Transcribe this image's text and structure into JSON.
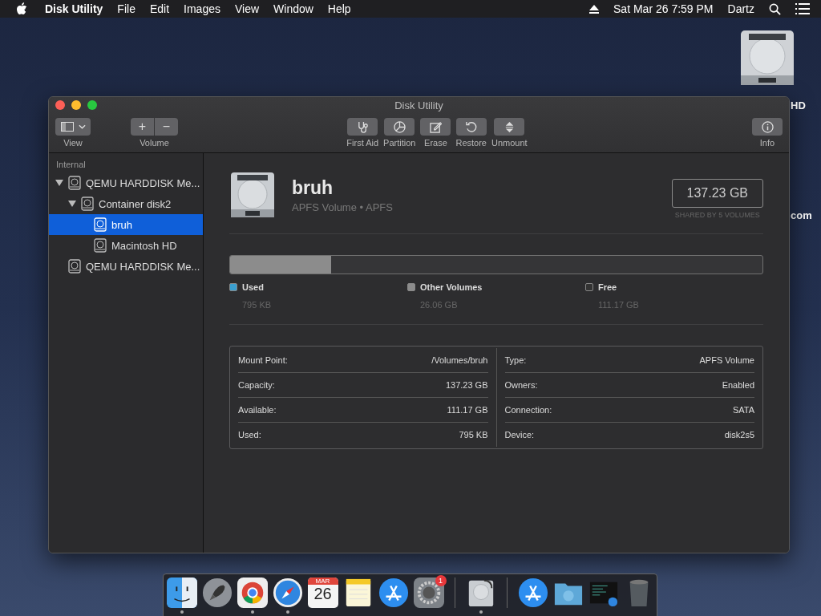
{
  "menu_bar": {
    "app_name": "Disk Utility",
    "menus": [
      "File",
      "Edit",
      "Images",
      "View",
      "Window",
      "Help"
    ],
    "clock": "Sat Mar 26  7:59 PM",
    "user": "Dartz"
  },
  "desktop": {
    "labels": [
      "HD",
      "com"
    ]
  },
  "window": {
    "title": "Disk Utility",
    "toolbar": {
      "view_label": "View",
      "volume_label": "Volume",
      "volume_buttons": [
        "+",
        "−"
      ],
      "actions": [
        {
          "kind": "first-aid",
          "label": "First Aid"
        },
        {
          "kind": "partition",
          "label": "Partition"
        },
        {
          "kind": "erase",
          "label": "Erase"
        },
        {
          "kind": "restore",
          "label": "Restore"
        },
        {
          "kind": "unmount",
          "label": "Unmount"
        }
      ],
      "info_label": "Info"
    },
    "sidebar": {
      "section": "Internal",
      "items": [
        {
          "name": "QEMU HARDDISK Me...",
          "selected": false,
          "expanded": true,
          "children": [
            {
              "name": "Container disk2",
              "selected": false,
              "expanded": true,
              "children": [
                {
                  "name": "bruh",
                  "selected": true
                },
                {
                  "name": "Macintosh HD",
                  "selected": false
                }
              ]
            }
          ]
        },
        {
          "name": "QEMU HARDDISK Me...",
          "selected": false
        }
      ]
    },
    "volume": {
      "name": "bruh",
      "subtitle": "APFS Volume • APFS",
      "size": "137.23 GB",
      "shared": "SHARED BY 5 VOLUMES",
      "usage_bar": {
        "level": 0.19
      },
      "usage": [
        {
          "label": "Used",
          "value": "795 KB",
          "color": "#3a9fd0"
        },
        {
          "label": "Other Volumes",
          "value": "26.06 GB",
          "color": "#8c8c8c"
        },
        {
          "label": "Free",
          "value": "111.17 GB",
          "color": "#333333"
        }
      ],
      "info_left": [
        {
          "label": "Mount Point:",
          "value": "/Volumes/bruh"
        },
        {
          "label": "Capacity:",
          "value": "137.23 GB"
        },
        {
          "label": "Available:",
          "value": "111.17 GB"
        },
        {
          "label": "Used:",
          "value": "795 KB"
        }
      ],
      "info_right": [
        {
          "label": "Type:",
          "value": "APFS Volume"
        },
        {
          "label": "Owners:",
          "value": "Enabled"
        },
        {
          "label": "Connection:",
          "value": "SATA"
        },
        {
          "label": "Device:",
          "value": "disk2s5"
        }
      ]
    }
  },
  "dock": {
    "items": [
      {
        "kind": "finder",
        "running": true
      },
      {
        "kind": "launchpad",
        "running": false
      },
      {
        "kind": "chrome",
        "running": true
      },
      {
        "kind": "safari",
        "running": true
      },
      {
        "kind": "calendar",
        "running": false,
        "month": "MAR",
        "day": "26"
      },
      {
        "kind": "notes",
        "running": false
      },
      {
        "kind": "appstore",
        "running": false
      },
      {
        "kind": "preferences",
        "running": false,
        "badge": "1"
      },
      {
        "kind": "separator"
      },
      {
        "kind": "diskutility",
        "running": true
      },
      {
        "kind": "separator"
      },
      {
        "kind": "appstore",
        "running": false
      },
      {
        "kind": "downloads",
        "running": false
      },
      {
        "kind": "terminal",
        "running": false
      },
      {
        "kind": "trash",
        "running": false
      }
    ]
  }
}
